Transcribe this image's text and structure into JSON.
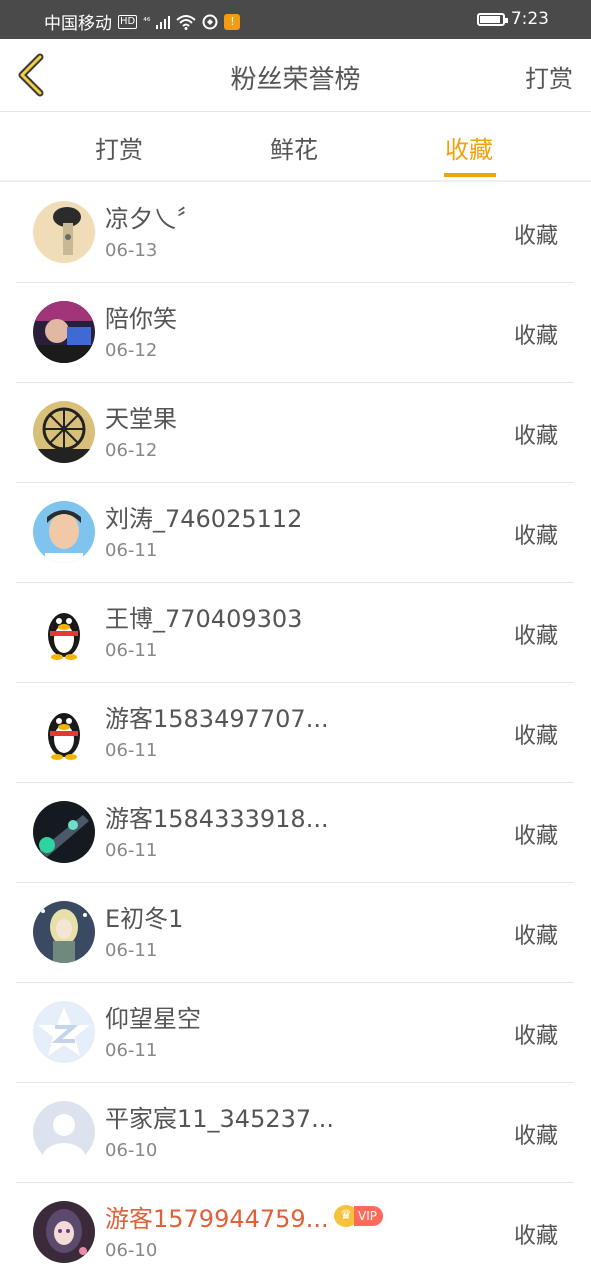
{
  "status_bar": {
    "carrier": "中国移动",
    "hd": "HD",
    "signal": "⁴⁶",
    "alert": "!",
    "time": "7:23"
  },
  "nav": {
    "title": "粉丝荣誉榜",
    "right_action": "打赏"
  },
  "tabs": [
    {
      "label": "打赏",
      "active": false
    },
    {
      "label": "鲜花",
      "active": false
    },
    {
      "label": "收藏",
      "active": true
    }
  ],
  "accent_color": "#f2a20c",
  "list": [
    {
      "name": "凉夕乀〞",
      "date": "06-13",
      "action": "收藏",
      "avatar": "photo"
    },
    {
      "name": "陪你笑",
      "date": "06-12",
      "action": "收藏",
      "avatar": "photo"
    },
    {
      "name": "天堂果",
      "date": "06-12",
      "action": "收藏",
      "avatar": "ferris-wheel"
    },
    {
      "name": "刘涛_746025112",
      "date": "06-11",
      "action": "收藏",
      "avatar": "photo"
    },
    {
      "name": "王博_770409303",
      "date": "06-11",
      "action": "收藏",
      "avatar": "qq-penguin"
    },
    {
      "name": "游客1583497707...",
      "date": "06-11",
      "action": "收藏",
      "avatar": "qq-penguin"
    },
    {
      "name": "游客1584333918...",
      "date": "06-11",
      "action": "收藏",
      "avatar": "photo"
    },
    {
      "name": "E初冬1",
      "date": "06-11",
      "action": "收藏",
      "avatar": "anime"
    },
    {
      "name": "仰望星空",
      "date": "06-11",
      "action": "收藏",
      "avatar": "qzone-star"
    },
    {
      "name": "平家宸11_345237...",
      "date": "06-10",
      "action": "收藏",
      "avatar": "default-person"
    },
    {
      "name": "游客1579944759...",
      "date": "06-10",
      "action": "收藏",
      "avatar": "anime",
      "vip": "VIP"
    }
  ]
}
